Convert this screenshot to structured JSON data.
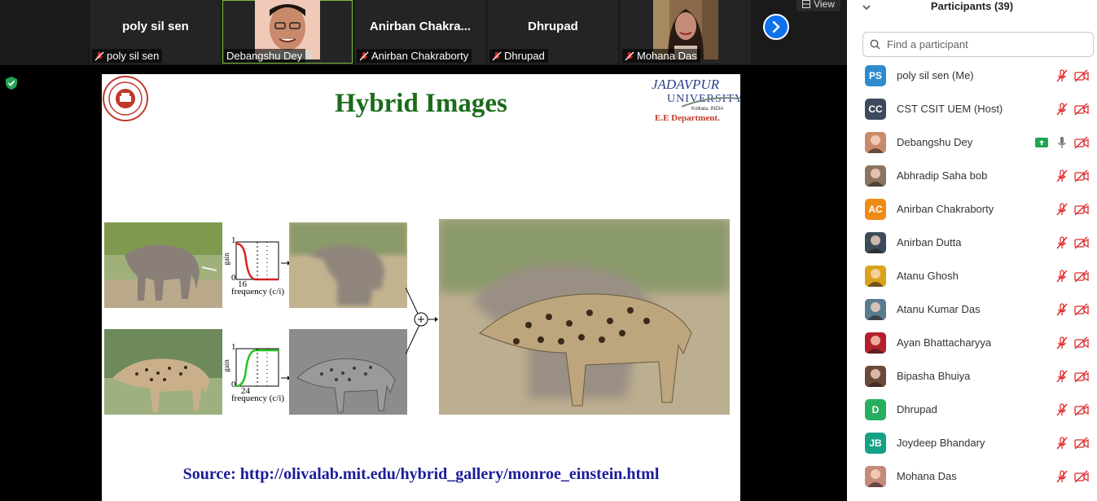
{
  "video_strip": {
    "tiles": [
      {
        "big_name": "poly sil sen",
        "label": "poly sil sen"
      },
      {
        "big_name": "",
        "label": "Debangshu Dey"
      },
      {
        "big_name": "Anirban  Chakra...",
        "label": "Anirban Chakraborty"
      },
      {
        "big_name": "Dhrupad",
        "label": "Dhrupad"
      },
      {
        "big_name": "",
        "label": "Mohana Das"
      }
    ],
    "view_label": "View"
  },
  "slide": {
    "title": "Hybrid Images",
    "logo_right": {
      "line1": "JADAVPUR",
      "line2": "UNIVERSITY",
      "line3": "Kolkata, INDIA",
      "dept": "E.E Department."
    },
    "plot_top": {
      "y_label": "gain",
      "tick_1": "1",
      "tick_0": "0",
      "x_tick": "16",
      "x_label": "frequency (c/i)"
    },
    "plot_bottom": {
      "y_label": "gain",
      "tick_1": "1",
      "tick_0": "0",
      "x_tick": "24",
      "x_label": "frequency (c/i)"
    },
    "source": "Source: http://olivalab.mit.edu/hybrid_gallery/monroe_einstein.html"
  },
  "panel": {
    "title": "Participants (39)",
    "search_placeholder": "Find a participant",
    "participants": [
      {
        "name": "poly sil sen (Me)",
        "initials": "PS",
        "color": "#2d8ccf",
        "photo": false,
        "sharing": false
      },
      {
        "name": "CST CSIT UEM (Host)",
        "initials": "CC",
        "color": "#3d4a5c",
        "photo": false,
        "sharing": false
      },
      {
        "name": "Debangshu Dey",
        "initials": "",
        "color": "#c98a6b",
        "photo": true,
        "sharing": true
      },
      {
        "name": "Abhradip Saha bob",
        "initials": "",
        "color": "#8a7560",
        "photo": true,
        "sharing": false
      },
      {
        "name": "Anirban Chakraborty",
        "initials": "AC",
        "color": "#ef8a16",
        "photo": false,
        "sharing": false
      },
      {
        "name": "Anirban Dutta",
        "initials": "",
        "color": "#3c4b5a",
        "photo": true,
        "sharing": false
      },
      {
        "name": "Atanu Ghosh",
        "initials": "",
        "color": "#d9a21b",
        "photo": true,
        "sharing": false
      },
      {
        "name": "Atanu Kumar Das",
        "initials": "",
        "color": "#5a7a8f",
        "photo": true,
        "sharing": false
      },
      {
        "name": "Ayan Bhattacharyya",
        "initials": "",
        "color": "#b3202a",
        "photo": true,
        "sharing": false
      },
      {
        "name": "Bipasha Bhuiya",
        "initials": "",
        "color": "#6b4a3a",
        "photo": true,
        "sharing": false
      },
      {
        "name": "Dhrupad",
        "initials": "D",
        "color": "#27ae60",
        "photo": false,
        "sharing": false
      },
      {
        "name": "Joydeep Bhandary",
        "initials": "JB",
        "color": "#16a085",
        "photo": false,
        "sharing": false
      },
      {
        "name": "Mohana Das",
        "initials": "",
        "color": "#c58b7a",
        "photo": true,
        "sharing": false
      }
    ]
  }
}
